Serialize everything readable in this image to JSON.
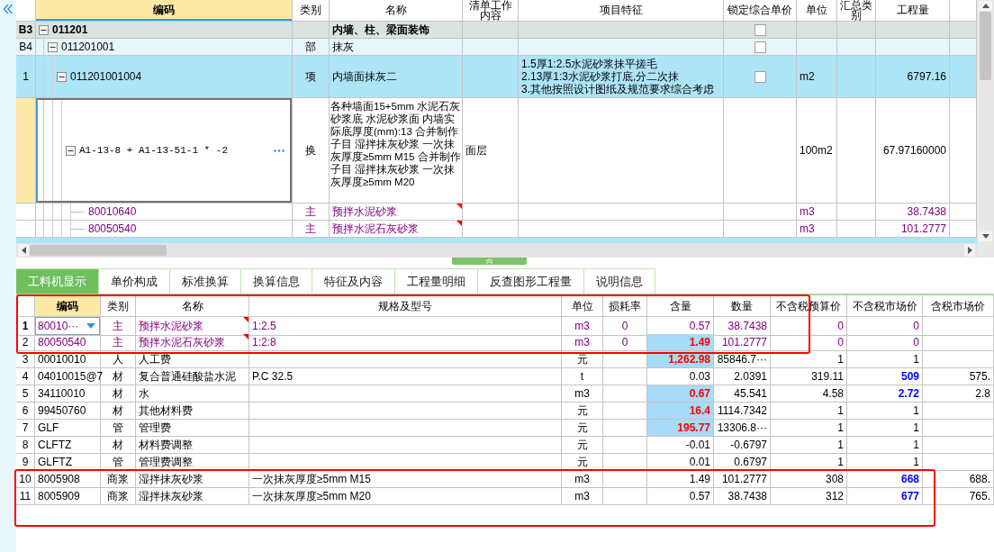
{
  "bill_table": {
    "columns": [
      {
        "label": "编码",
        "selected": true
      },
      {
        "label": "类别",
        "selected": false
      },
      {
        "label": "名称",
        "selected": false
      },
      {
        "label": "清单工作内容",
        "selected": false
      },
      {
        "label": "项目特征",
        "selected": false
      },
      {
        "label": "锁定综合单价",
        "selected": false
      },
      {
        "label": "单位",
        "selected": false
      },
      {
        "label": "汇总类别",
        "selected": false
      },
      {
        "label": "工程量",
        "selected": false
      }
    ],
    "rows": [
      {
        "kind": "section",
        "row_header": "B3",
        "code": "011201",
        "name": "内墙、柱、梁面装饰",
        "locked": false,
        "expanded": true,
        "selected": false,
        "children": [
          {
            "kind": "division",
            "row_header": "B4",
            "code": "011201001",
            "type": "部",
            "name": "抹灰",
            "locked": false,
            "expanded": true,
            "selected": false,
            "children": [
              {
                "kind": "item",
                "row_header": "1",
                "code": "011201001004",
                "type": "项",
                "name": "内墙面抹灰二",
                "features": [
                  "1.5厚1:2.5水泥砂浆抹平搓毛",
                  "2.13厚1:3水泥砂浆打底,分二次抹",
                  "3.其他按照设计图纸及规范要求综合考虑"
                ],
                "locked": false,
                "unit": "m2",
                "quantity": "6797.16",
                "expanded": true,
                "selected": false,
                "children": [
                  {
                    "kind": "norm",
                    "code": "A1-13-8 + A1-13-51-1 * -2",
                    "type": "换",
                    "name": "各种墙面15+5mm 水泥石灰砂浆底 水泥砂浆面 内墙实际底厚度(mm):13 合并制作子目 湿拌抹灰砂浆 一次抹灰厚度≥5mm M15 合并制作子目 湿拌抹灰砂浆 一次抹灰厚度≥5mm M20",
                    "work_content": "面层",
                    "unit": "100m2",
                    "quantity": "67.97160000",
                    "expanded": true,
                    "selected": true,
                    "children": [
                      {
                        "kind": "material",
                        "code": "80010640",
                        "type": "主",
                        "name": "预拌水泥砂浆",
                        "unit": "m3",
                        "quantity": "38.7438",
                        "note": true,
                        "selected": false
                      },
                      {
                        "kind": "material",
                        "code": "80050540",
                        "type": "主",
                        "name": "预拌水泥石灰砂浆",
                        "unit": "m3",
                        "quantity": "101.2777",
                        "note": true,
                        "selected": false
                      }
                    ]
                  }
                ]
              }
            ]
          }
        ]
      }
    ]
  },
  "tabs": [
    {
      "label": "工料机显示",
      "selected": true
    },
    {
      "label": "单价构成",
      "selected": false
    },
    {
      "label": "标准换算",
      "selected": false
    },
    {
      "label": "换算信息",
      "selected": false
    },
    {
      "label": "特征及内容",
      "selected": false
    },
    {
      "label": "工程量明细",
      "selected": false
    },
    {
      "label": "反查图形工程量",
      "selected": false
    },
    {
      "label": "说明信息",
      "selected": false
    }
  ],
  "material_table": {
    "columns": [
      {
        "label": "编码",
        "selected": true
      },
      {
        "label": "类别",
        "selected": false
      },
      {
        "label": "名称",
        "selected": false
      },
      {
        "label": "规格及型号",
        "selected": false
      },
      {
        "label": "单位",
        "selected": false
      },
      {
        "label": "损耗率",
        "selected": false
      },
      {
        "label": "含量",
        "selected": false
      },
      {
        "label": "数量",
        "selected": false
      },
      {
        "label": "不含税预算价",
        "selected": false
      },
      {
        "label": "不含税市场价",
        "selected": false
      },
      {
        "label": "含税市场价",
        "selected": false
      }
    ],
    "rows": [
      {
        "row_header": "1",
        "kind": "main",
        "code": "80010···",
        "type": "主",
        "name": "预拌水泥砂浆",
        "spec": "1:2.5",
        "unit": "m3",
        "loss_rate": "0",
        "content": "0.57",
        "quantity": "38.7438",
        "budget_price": "0",
        "market_price": "0",
        "selected": true,
        "note": true,
        "content_modified": false,
        "price_adjusted": false
      },
      {
        "row_header": "2",
        "kind": "main",
        "code": "80050540",
        "type": "主",
        "name": "预拌水泥石灰砂浆",
        "spec": "1:2:8",
        "unit": "m3",
        "loss_rate": "0",
        "content": "1.49",
        "quantity": "101.2777",
        "budget_price": "0",
        "market_price": "0",
        "selected": false,
        "note": true,
        "content_modified": true,
        "price_adjusted": false
      },
      {
        "row_header": "3",
        "kind": "regular",
        "code": "00010010",
        "type": "人",
        "name": "人工费",
        "unit": "元",
        "content": "1,262.98",
        "quantity": "85846.7···",
        "budget_price": "1",
        "market_price": "1",
        "selected": false,
        "note": false,
        "content_modified": true,
        "price_adjusted": false
      },
      {
        "row_header": "4",
        "kind": "regular",
        "code": "04010015@7",
        "type": "材",
        "name": "复合普通硅酸盐水泥",
        "spec": "P.C 32.5",
        "unit": "t",
        "content": "0.03",
        "quantity": "2.0391",
        "budget_price": "319.11",
        "market_price": "509",
        "tax_market_price": "575.",
        "selected": false,
        "note": false,
        "content_modified": false,
        "price_adjusted": true
      },
      {
        "row_header": "5",
        "kind": "regular",
        "code": "34110010",
        "type": "材",
        "name": "水",
        "unit": "m3",
        "content": "0.67",
        "quantity": "45.541",
        "budget_price": "4.58",
        "market_price": "2.72",
        "tax_market_price": "2.8",
        "selected": false,
        "note": false,
        "content_modified": true,
        "price_adjusted": true
      },
      {
        "row_header": "6",
        "kind": "regular",
        "code": "99450760",
        "type": "材",
        "name": "其他材料费",
        "unit": "元",
        "content": "16.4",
        "quantity": "1114.7342",
        "budget_price": "1",
        "market_price": "1",
        "selected": false,
        "note": false,
        "content_modified": true,
        "price_adjusted": false
      },
      {
        "row_header": "7",
        "kind": "regular",
        "code": "GLF",
        "type": "管",
        "name": "管理费",
        "unit": "元",
        "content": "195.77",
        "quantity": "13306.8···",
        "budget_price": "1",
        "market_price": "1",
        "selected": false,
        "note": false,
        "content_modified": true,
        "price_adjusted": false
      },
      {
        "row_header": "8",
        "kind": "regular",
        "code": "CLFTZ",
        "type": "材",
        "name": "材料费调整",
        "unit": "元",
        "content": "-0.01",
        "quantity": "-0.6797",
        "budget_price": "1",
        "market_price": "1",
        "selected": false,
        "note": false,
        "content_modified": false,
        "price_adjusted": false
      },
      {
        "row_header": "9",
        "kind": "regular",
        "code": "GLFTZ",
        "type": "管",
        "name": "管理费调整",
        "unit": "元",
        "content": "0.01",
        "quantity": "0.6797",
        "budget_price": "1",
        "market_price": "1",
        "selected": false,
        "note": false,
        "content_modified": false,
        "price_adjusted": false
      },
      {
        "row_header": "10",
        "kind": "regular",
        "code": "8005908",
        "type": "商浆",
        "name": "湿拌抹灰砂浆",
        "spec": "一次抹灰厚度≥5mm M15",
        "unit": "m3",
        "content": "1.49",
        "quantity": "101.2777",
        "budget_price": "308",
        "market_price": "668",
        "tax_market_price": "688.",
        "selected": false,
        "note": false,
        "content_modified": false,
        "price_adjusted": true
      },
      {
        "row_header": "11",
        "kind": "regular",
        "code": "8005909",
        "type": "商浆",
        "name": "湿拌抹灰砂浆",
        "spec": "一次抹灰厚度≥5mm M20",
        "unit": "m3",
        "content": "0.57",
        "quantity": "38.7438",
        "budget_price": "312",
        "market_price": "677",
        "tax_market_price": "765.",
        "selected": false,
        "note": false,
        "content_modified": false,
        "price_adjusted": true
      }
    ]
  },
  "markup_frames": [
    {
      "kind": "rectangle"
    },
    {
      "kind": "rectangle"
    }
  ]
}
